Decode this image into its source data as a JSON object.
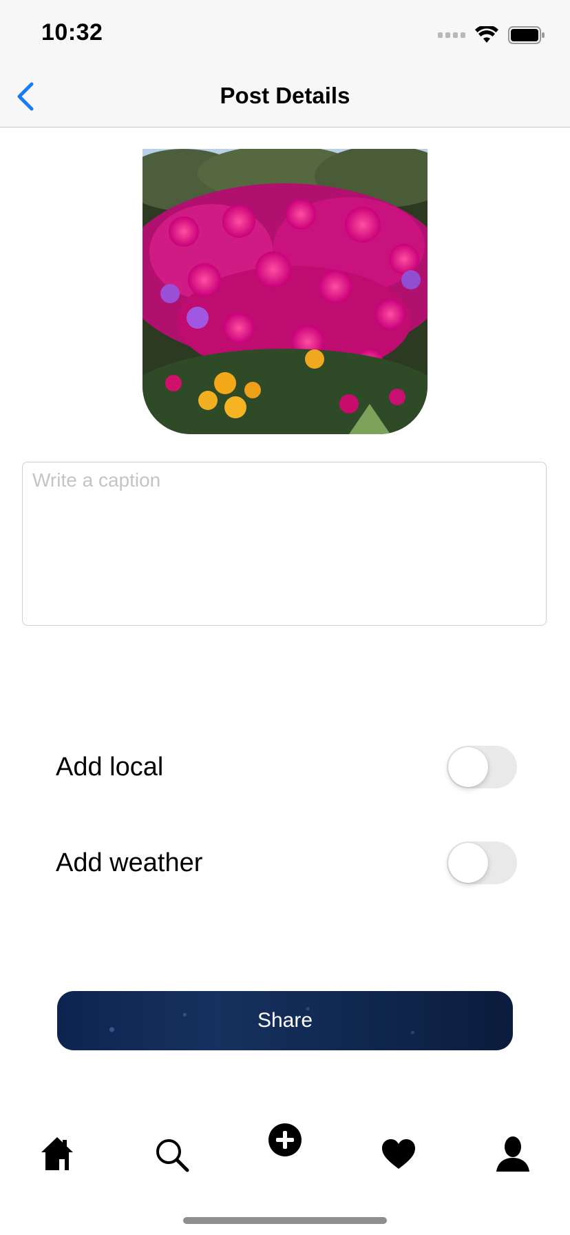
{
  "status_bar": {
    "time": "10:32"
  },
  "nav": {
    "title": "Post Details"
  },
  "caption": {
    "placeholder": "Write a caption",
    "value": ""
  },
  "options": [
    {
      "label": "Add local",
      "on": false
    },
    {
      "label": "Add weather",
      "on": false
    }
  ],
  "share": {
    "label": "Share"
  },
  "tabbar": {
    "items": [
      {
        "icon": "home-icon"
      },
      {
        "icon": "search-icon"
      },
      {
        "icon": "add-icon"
      },
      {
        "icon": "heart-icon"
      },
      {
        "icon": "profile-icon"
      }
    ]
  },
  "colors": {
    "accent": "#1a7cf5",
    "share_bg": "#12295a",
    "toggle_off": "#e9e9ea"
  }
}
